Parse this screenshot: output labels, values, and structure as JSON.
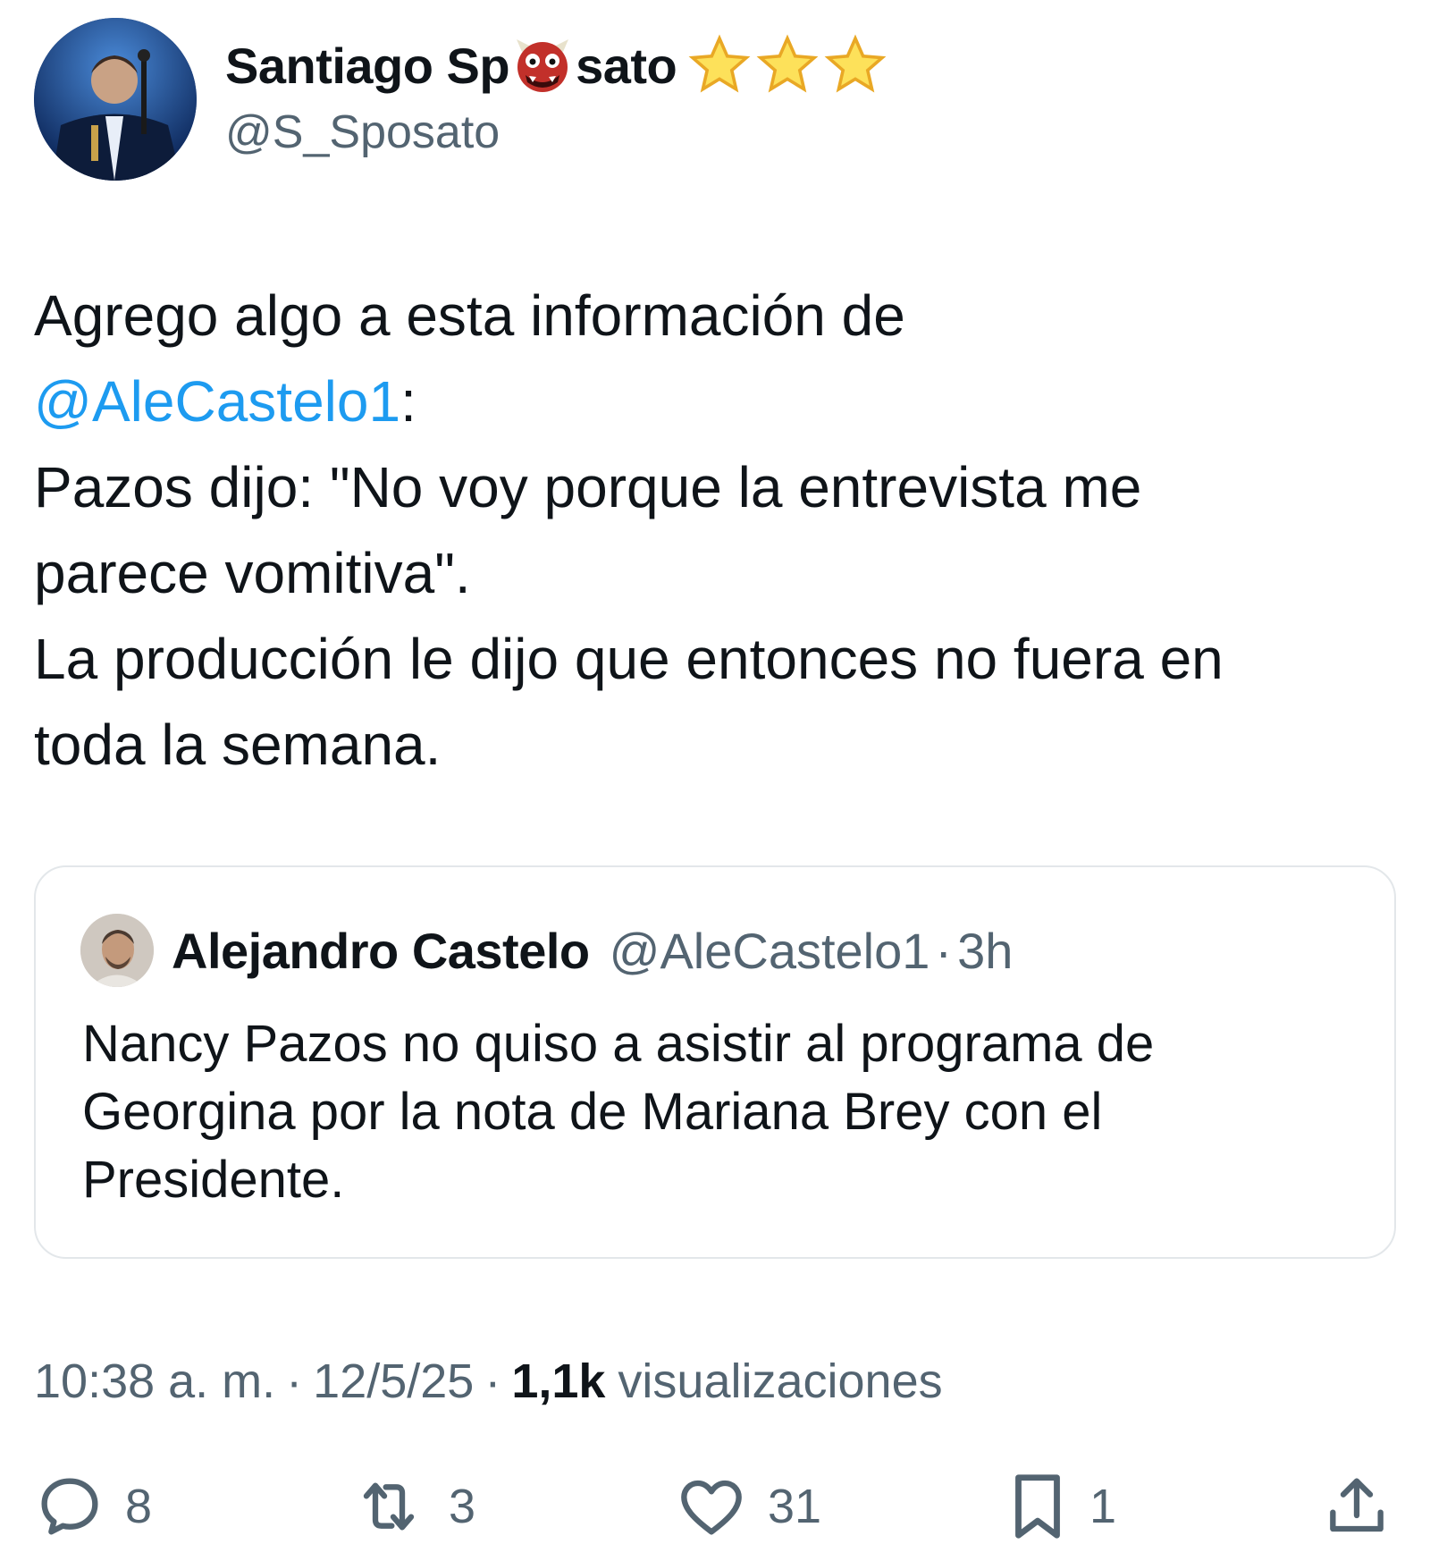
{
  "author": {
    "name_part1": "Santiago Sp",
    "name_part2": "sato",
    "name_emoji": "japanese-ogre-emoji",
    "badge_icons": [
      "star-icon",
      "star-icon",
      "star-icon"
    ],
    "handle": "@S_Sposato"
  },
  "tweet": {
    "line1": "Agrego algo a esta información de",
    "mention": "@AleCastelo1",
    "mention_suffix": ":",
    "line3": "Pazos dijo: \"No voy porque la entrevista me",
    "line4": "parece vomitiva\".",
    "line5": "La producción le dijo que entonces no fuera en",
    "line6": "toda la semana."
  },
  "quote": {
    "name": "Alejandro Castelo",
    "handle": "@AleCastelo1",
    "separator": "·",
    "time": "3h",
    "line1": "Nancy Pazos no quiso a asistir al programa de",
    "line2": "Georgina por la nota de Mariana Brey con el",
    "line3": "Presidente."
  },
  "meta": {
    "time": "10:38 a. m.",
    "separator": "·",
    "date": "12/5/25",
    "views_count": "1,1k",
    "views_label": "visualizaciones"
  },
  "actions": {
    "replies": "8",
    "retweets": "3",
    "likes": "31",
    "bookmarks": "1"
  },
  "colors": {
    "text": "#0f1419",
    "secondary": "#536471",
    "link": "#1d9bf0",
    "border": "#e3e7ea"
  }
}
